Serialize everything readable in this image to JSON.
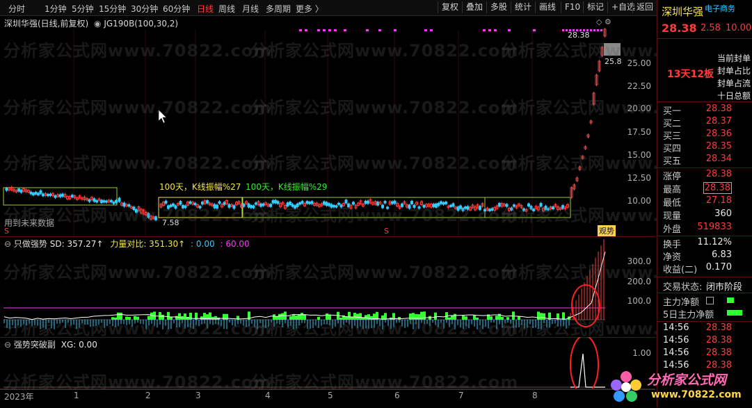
{
  "toolbar": {
    "periods": [
      "分时",
      "1分钟",
      "5分钟",
      "15分钟",
      "30分钟",
      "60分钟",
      "日线",
      "周线",
      "月线",
      "多周期",
      "更多 〉"
    ],
    "active_period": "日线",
    "buttons": [
      "复权",
      "叠加",
      "多股",
      "统计",
      "画线",
      "F10",
      "标记",
      "+自选",
      "返回"
    ]
  },
  "main_chart": {
    "title": "深圳华强(日线,前复权)",
    "indicator": "JG190B(100,30,2)",
    "price_labels": [
      "25.00",
      "22.50",
      "20.00",
      "17.50",
      "15.00",
      "12.50",
      "10.00"
    ],
    "high_mark": "28.38",
    "side_mark": "25.8",
    "low_mark": "7.58",
    "note1": "100天，K线振幅%27",
    "note2": "100天，K线振幅%29",
    "note_future": "用到未来数据",
    "s_marker": "S",
    "tag": "观势"
  },
  "sub1": {
    "title": "只做强势",
    "sd": "SD: 357.27↑",
    "force": "力量对比: 351.30↑",
    "v1": ": 0.00",
    "v2": ": 60.00",
    "labels": [
      "300.0",
      "200.0",
      "100.0"
    ]
  },
  "sub2": {
    "title": "强势突破副",
    "xg": "XG: 0.00",
    "labels": [
      "1.00"
    ]
  },
  "x_axis": [
    "2023年",
    "1",
    "2",
    "3",
    "4",
    "5",
    "6",
    "7",
    "8"
  ],
  "stock": {
    "name": "深圳华强",
    "sector": "电子商务",
    "price": "28.38",
    "change": "2.58",
    "pct": "10.00",
    "streak": "13天12板",
    "limit_info": [
      "当前封单",
      "封单占比",
      "封单占流",
      "十日总额"
    ]
  },
  "bids": [
    {
      "label": "买一",
      "price": "28.38"
    },
    {
      "label": "买二",
      "price": "28.37"
    },
    {
      "label": "买三",
      "price": "28.36"
    },
    {
      "label": "买四",
      "price": "28.35"
    },
    {
      "label": "买五",
      "price": "28.34"
    }
  ],
  "quote": [
    {
      "label": "涨停",
      "value": "28.38",
      "cls": "red"
    },
    {
      "label": "最高",
      "value": "28.38",
      "cls": "red"
    },
    {
      "label": "最低",
      "value": "27.18",
      "cls": "red"
    },
    {
      "label": "现量",
      "value": "360",
      "cls": "white"
    },
    {
      "label": "外盘",
      "value": "519833",
      "cls": "red"
    }
  ],
  "stats": [
    {
      "label": "换手",
      "value": "11.12%"
    },
    {
      "label": "净资",
      "value": "6.83"
    },
    {
      "label": "收益(二)",
      "value": "0.170"
    }
  ],
  "trade_state": {
    "label": "交易状态:",
    "value": "闭市阶段"
  },
  "fund_flow": [
    {
      "label": "主力净额"
    },
    {
      "label": "5日主力净额"
    }
  ],
  "ticks": [
    {
      "time": "14:56",
      "price": "28.38"
    },
    {
      "time": "14:56",
      "price": "28.38"
    },
    {
      "time": "14:56",
      "price": "28.38"
    },
    {
      "time": "14:56",
      "price": "28.38"
    }
  ],
  "watermark": "分析家公式网www.70822.com",
  "logo": {
    "title": "分析家公式网",
    "url": "www.70822.com"
  },
  "colors": {
    "up": "#ff3b3b",
    "down": "#33ccff",
    "accent_green": "#33ff33",
    "magenta": "#ff33ff",
    "box": "#9acd32"
  }
}
